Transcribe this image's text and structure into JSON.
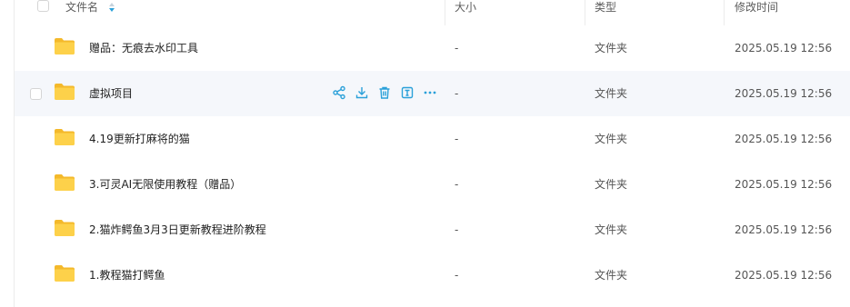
{
  "header": {
    "name_label": "文件名",
    "size_label": "大小",
    "type_label": "类型",
    "modified_label": "修改时间"
  },
  "accent_color": "#2aa0d9",
  "rows": [
    {
      "name": "赠品：无痕去水印工具",
      "size": "-",
      "type": "文件夹",
      "modified": "2025.05.19 12:56",
      "icon": "folder-icon"
    },
    {
      "name": "虚拟项目",
      "size": "-",
      "type": "文件夹",
      "modified": "2025.05.19 12:56",
      "icon": "folder-icon",
      "hovered": true
    },
    {
      "name": "4.19更新打麻将的猫",
      "size": "-",
      "type": "文件夹",
      "modified": "2025.05.19 12:56",
      "icon": "folder-icon"
    },
    {
      "name": "3.可灵AI无限使用教程（赠品）",
      "size": "-",
      "type": "文件夹",
      "modified": "2025.05.19 12:56",
      "icon": "folder-icon"
    },
    {
      "name": "2.猫炸鳄鱼3月3日更新教程进阶教程",
      "size": "-",
      "type": "文件夹",
      "modified": "2025.05.19 12:56",
      "icon": "folder-icon"
    },
    {
      "name": "1.教程猫打鳄鱼",
      "size": "-",
      "type": "文件夹",
      "modified": "2025.05.19 12:56",
      "icon": "folder-icon"
    }
  ],
  "row_actions": [
    "share-icon",
    "download-icon",
    "delete-icon",
    "rename-icon",
    "more-icon"
  ]
}
